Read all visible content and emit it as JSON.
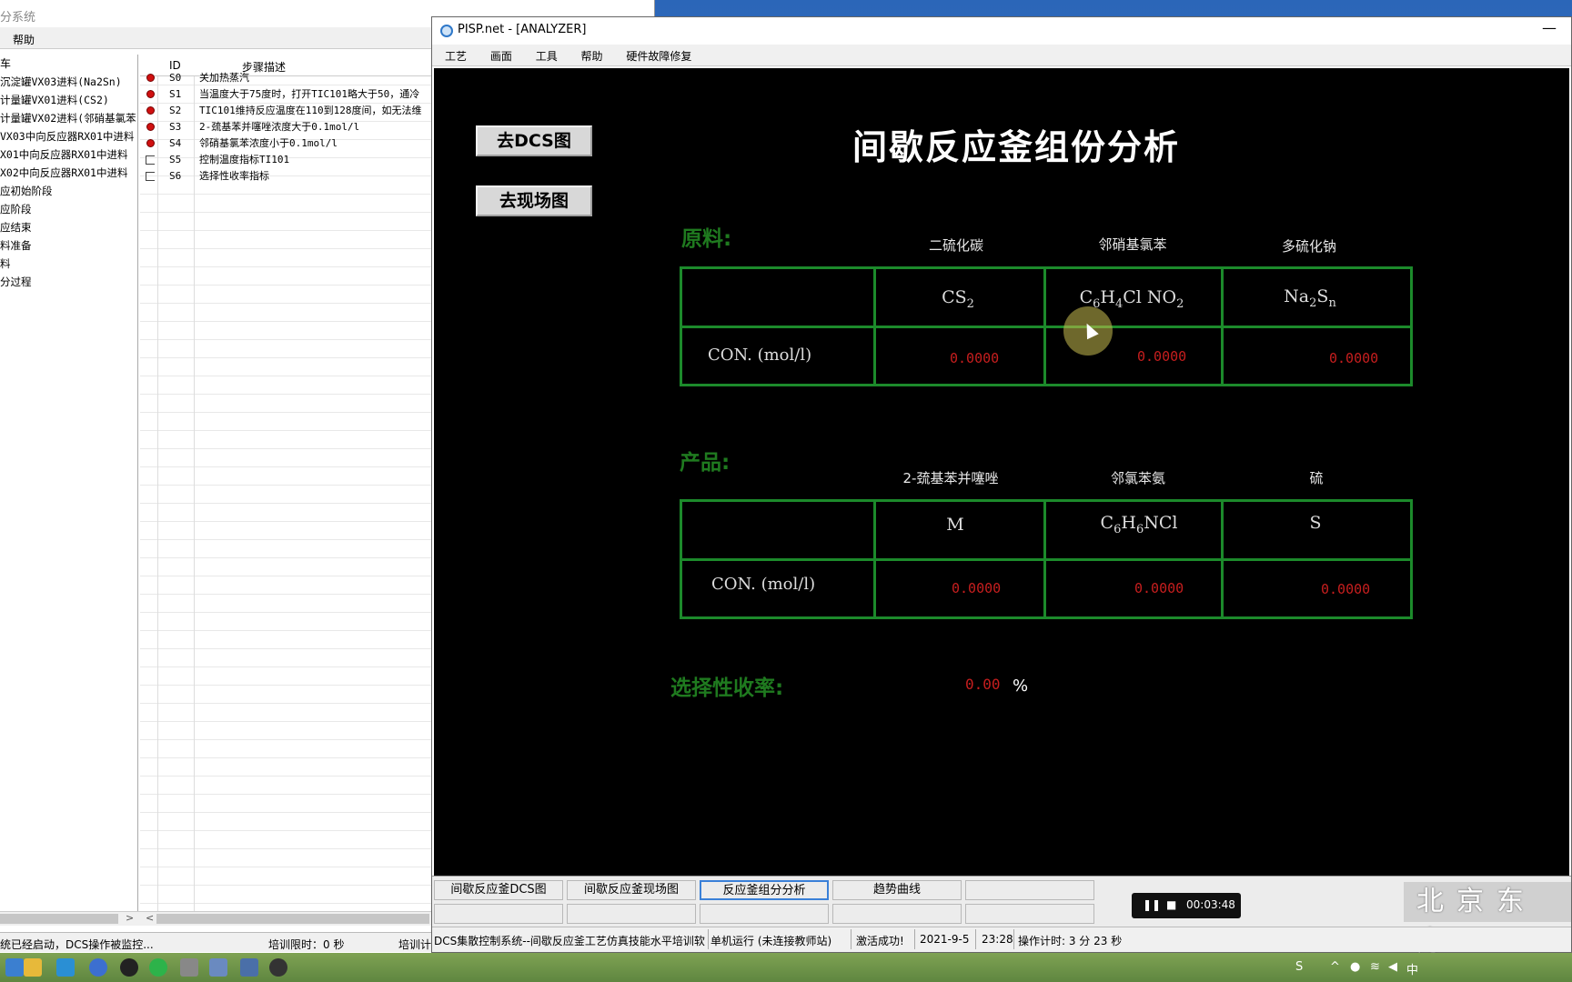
{
  "left_window": {
    "title": "分系统",
    "menu": [
      "帮助"
    ],
    "tree_items": [
      "车",
      "沉淀罐VX03进料(Na2Sn)",
      "计量罐VX01进料(CS2)",
      "计量罐VX02进料(邻硝基氯苯)",
      "VX03中向反应器RX01中进料",
      "X01中向反应器RX01中进料",
      "X02中向反应器RX01中进料",
      "应初始阶段",
      "应阶段",
      "应结束",
      "料准备",
      "料",
      "分过程"
    ],
    "steps_header": {
      "id": "ID",
      "desc": "步骤描述"
    },
    "steps": [
      {
        "marker": "dot",
        "id": "S0",
        "desc": "关加热蒸汽"
      },
      {
        "marker": "dot",
        "id": "S1",
        "desc": "当温度大于75度时，打开TIC101略大于50，通冷"
      },
      {
        "marker": "dot",
        "id": "S2",
        "desc": "TIC101维持反应温度在110到128度间，如无法维"
      },
      {
        "marker": "dot",
        "id": "S3",
        "desc": "2-巯基苯并噻唑浓度大于0.1mol/l"
      },
      {
        "marker": "dot",
        "id": "S4",
        "desc": "邻硝基氯苯浓度小于0.1mol/l"
      },
      {
        "marker": "box",
        "id": "S5",
        "desc": "控制温度指标TI101"
      },
      {
        "marker": "box",
        "id": "S6",
        "desc": "选择性收率指标"
      }
    ],
    "status": {
      "msg": "统已经启动，DCS操作被监控...",
      "limit": "培训限时：0 秒",
      "timer": "培训计"
    }
  },
  "pisp": {
    "title": "PISP.net - [ANALYZER]",
    "menu": [
      "工艺",
      "画面",
      "工具",
      "帮助",
      "硬件故障修复"
    ],
    "nav": {
      "dcs": "去DCS图",
      "field": "去现场图"
    },
    "main_title": "间歇反应釜组份分析",
    "raw": {
      "section": "原料:",
      "headers": [
        "二硫化碳",
        "邻硝基氯苯",
        "多硫化钠"
      ],
      "con_label": "CON. (mol/l)",
      "values": [
        "0.0000",
        "0.0000",
        "0.0000"
      ]
    },
    "product": {
      "section": "产品:",
      "headers": [
        "2-巯基苯并噻唑",
        "邻氯苯氨",
        "硫"
      ],
      "con_label": "CON. (mol/l)",
      "values": [
        "0.0000",
        "0.0000",
        "0.0000"
      ]
    },
    "formulas_raw": [
      {
        "parts": [
          [
            "CS",
            ""
          ],
          [
            "2",
            "sub"
          ]
        ]
      },
      {
        "parts": [
          [
            "C",
            ""
          ],
          [
            "6",
            "sub"
          ],
          [
            "H",
            ""
          ],
          [
            "4",
            "sub"
          ],
          [
            "Cl NO",
            ""
          ],
          [
            "2",
            "sub"
          ]
        ]
      },
      {
        "parts": [
          [
            "Na",
            ""
          ],
          [
            "2",
            "sub"
          ],
          [
            "S",
            ""
          ],
          [
            "n",
            "sub"
          ]
        ]
      }
    ],
    "formulas_product": [
      {
        "parts": [
          [
            "M",
            ""
          ]
        ]
      },
      {
        "parts": [
          [
            "C",
            ""
          ],
          [
            "6",
            "sub"
          ],
          [
            "H",
            ""
          ],
          [
            "6",
            "sub"
          ],
          [
            "NCl",
            ""
          ]
        ]
      },
      {
        "parts": [
          [
            "S",
            ""
          ]
        ]
      }
    ],
    "selectivity": {
      "label": "选择性收率:",
      "value": "0.00",
      "unit": "%"
    },
    "tabs": [
      {
        "label": "间歇反应釜DCS图",
        "active": false
      },
      {
        "label": "间歇反应釜现场图",
        "active": false
      },
      {
        "label": "反应釜组分分析",
        "active": true
      },
      {
        "label": "趋势曲线",
        "active": false
      },
      {
        "label": "",
        "active": false
      }
    ],
    "player_time": "00:03:48",
    "watermark": "北京东方",
    "statusbar": {
      "system": "DCS集散控制系统--间歇反应釜工艺仿真技能水平培训软",
      "mode": "单机运行 (未连接教师站)",
      "activation": "激活成功!",
      "date": "2021-9-5",
      "time": "23:28",
      "op_timer": "操作计时: 3 分 23 秒"
    }
  },
  "colors": {
    "table_green": "#1c8a2b",
    "value_red": "#c61e1e",
    "section_green": "#1f7a1f"
  }
}
